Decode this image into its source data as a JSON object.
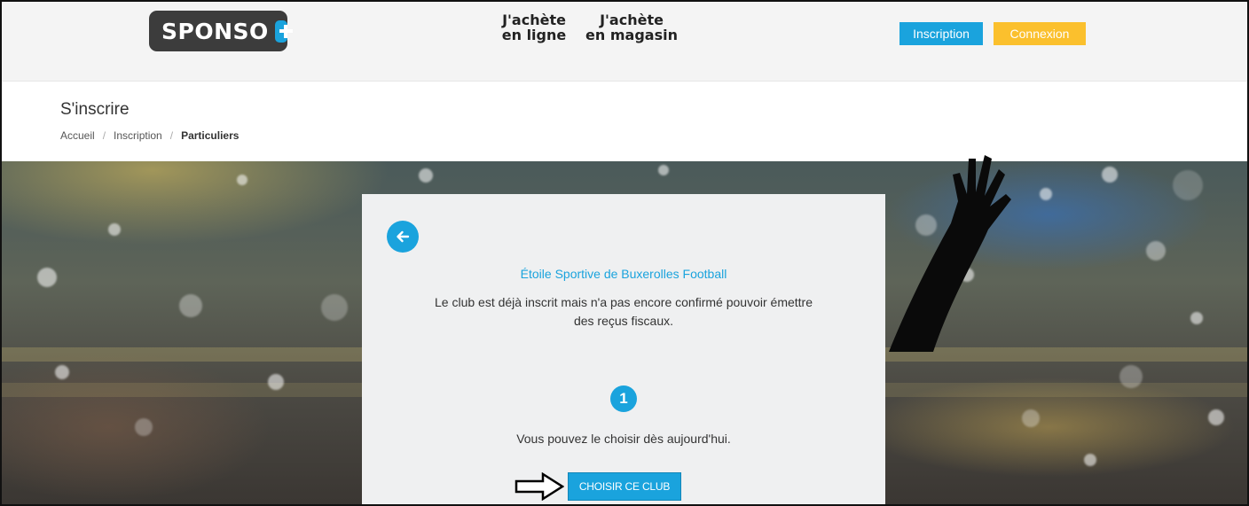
{
  "header": {
    "logo_text": "SPONSO",
    "nav": {
      "online_line1": "J'achète",
      "online_line2": "en ligne",
      "store_line1": "J'achète",
      "store_line2": "en magasin"
    },
    "inscription_label": "Inscription",
    "connexion_label": "Connexion"
  },
  "page": {
    "title": "S'inscrire",
    "breadcrumb": [
      "Accueil",
      "Inscription",
      "Particuliers"
    ]
  },
  "card": {
    "club_name": "Étoile Sportive de Buxerolles Football",
    "message": "Le club est déjà inscrit mais n'a pas encore confirmé pouvoir émettre des reçus fiscaux.",
    "step_number": "1",
    "step_message": "Vous pouvez le choisir dès aujourd'hui.",
    "choose_label": "CHOISIR CE CLUB"
  },
  "colors": {
    "primary": "#1aa3dd",
    "accent": "#fbc02d",
    "logo_bg": "#3c3c3c",
    "card_bg": "#eff0f1",
    "header_bg": "#f4f4f4"
  },
  "icons": {
    "back": "arrow-left-icon",
    "logo_plus": "plus-icon",
    "pointer": "right-arrow-icon"
  }
}
